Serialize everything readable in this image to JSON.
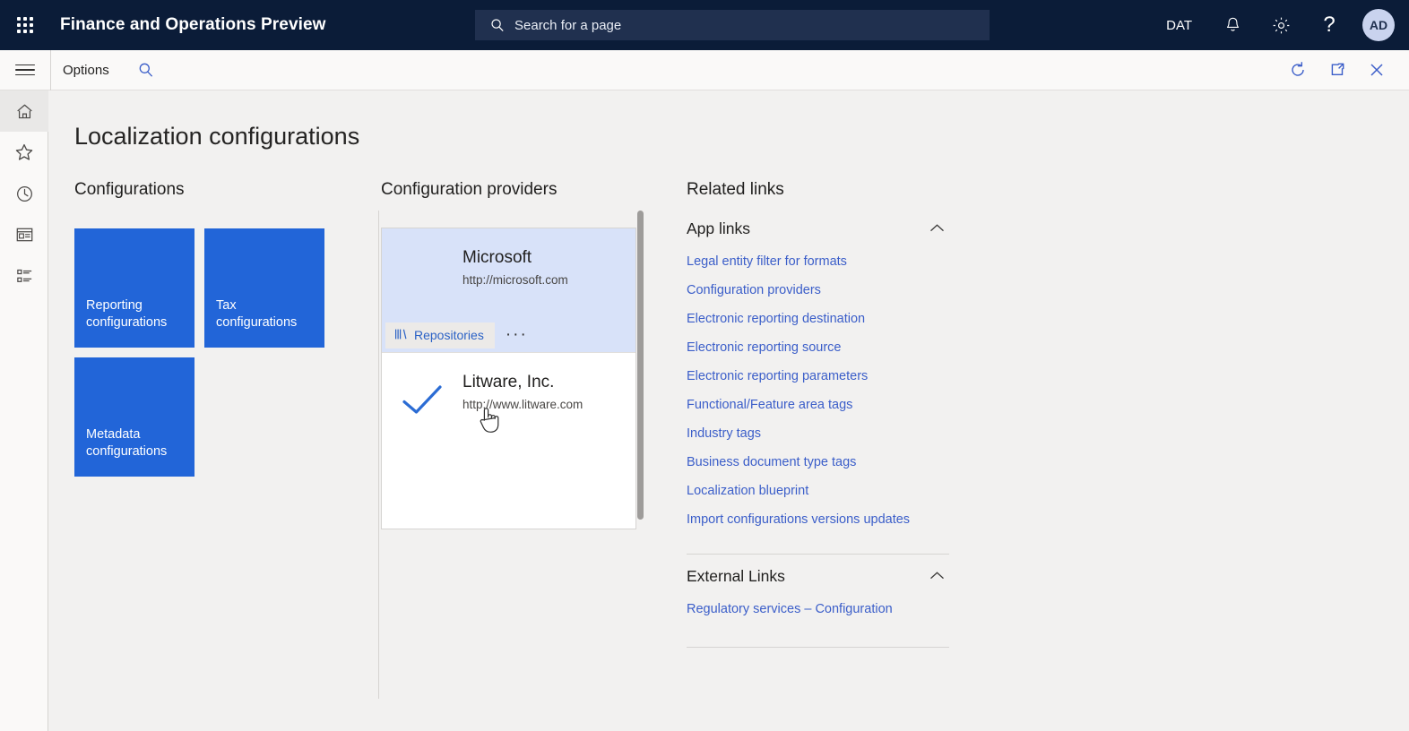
{
  "topnav": {
    "waffle_icon": "app-launcher-icon",
    "title": "Finance and Operations Preview",
    "search": {
      "icon": "search-icon",
      "placeholder": "Search for a page",
      "value": ""
    },
    "company": "DAT",
    "notifications_icon": "bell-icon",
    "settings_icon": "gear-icon",
    "help_icon": "question-mark-icon",
    "avatar_initials": "AD"
  },
  "commandbar": {
    "menu_icon": "hamburger-icon",
    "options_label": "Options",
    "search_icon": "search-icon",
    "refresh_icon": "refresh-icon",
    "popout_icon": "open-in-new-window-icon",
    "close_icon": "close-icon"
  },
  "rail": {
    "items": [
      {
        "name": "home",
        "icon": "home-icon",
        "active": true
      },
      {
        "name": "favorites",
        "icon": "star-icon",
        "active": false
      },
      {
        "name": "recent",
        "icon": "clock-icon",
        "active": false
      },
      {
        "name": "workspaces",
        "icon": "workspace-icon",
        "active": false
      },
      {
        "name": "modules",
        "icon": "list-icon",
        "active": false
      }
    ]
  },
  "page": {
    "title": "Localization configurations"
  },
  "configurations": {
    "heading": "Configurations",
    "tiles": [
      {
        "line1": "Reporting",
        "line2": "configurations",
        "color": "#2265d8"
      },
      {
        "line1": "Tax",
        "line2": "configurations",
        "color": "#2265d8"
      },
      {
        "line1": "Metadata",
        "line2": "configurations",
        "color": "#2265d8"
      }
    ]
  },
  "providers": {
    "heading": "Configuration providers",
    "cards": [
      {
        "name": "Microsoft",
        "url": "http://microsoft.com",
        "selected": true,
        "checked": false,
        "repositories_label": "Repositories",
        "repositories_icon": "books-icon",
        "more_label": "···"
      },
      {
        "name": "Litware, Inc.",
        "url": "http://www.litware.com",
        "selected": false,
        "checked": true,
        "check_icon": "checkmark-icon"
      }
    ]
  },
  "related": {
    "heading": "Related links",
    "sections": [
      {
        "title": "App links",
        "chevron_icon": "chevron-up-icon",
        "links": [
          "Legal entity filter for formats",
          "Configuration providers",
          "Electronic reporting destination",
          "Electronic reporting source",
          "Electronic reporting parameters",
          "Functional/Feature area tags",
          "Industry tags",
          "Business document type tags",
          "Localization blueprint",
          "Import configurations versions updates"
        ]
      },
      {
        "title": "External Links",
        "chevron_icon": "chevron-up-icon",
        "links": [
          "Regulatory services – Configuration"
        ]
      }
    ]
  },
  "colors": {
    "topnav_bg": "#0b1c38",
    "tile_blue": "#2265d8",
    "link_blue": "#3b5ec9",
    "selected_card_bg": "#d8e2f9",
    "page_bg": "#f2f1f0"
  }
}
